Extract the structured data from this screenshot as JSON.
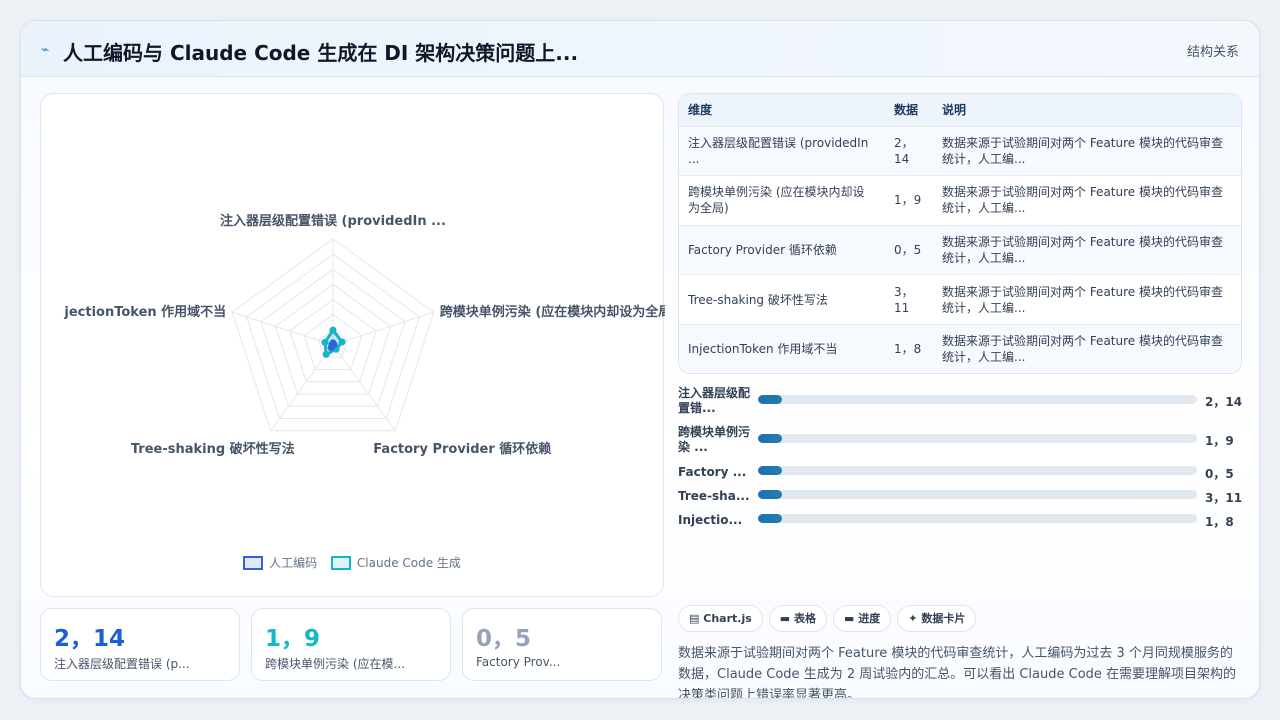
{
  "header": {
    "icon": "sparkline-icon",
    "title": "人工编码与 Claude Code 生成在 DI 架构决策问题上...",
    "tag": "结构关系"
  },
  "chart_data": {
    "type": "radar",
    "axes": [
      "注入器层级配置错误 (providedIn ...",
      "跨模块单例污染 (应在模块内却设为全局",
      "Factory Provider 循环依赖",
      "Tree-shaking 破坏性写法",
      "jectionToken 作用域不当"
    ],
    "series": [
      {
        "name": "人工编码",
        "values": [
          2,
          1,
          0,
          3,
          1
        ],
        "color": "#3163d8"
      },
      {
        "name": "Claude Code 生成",
        "values": [
          14,
          9,
          5,
          11,
          8
        ],
        "color": "#19b3c8"
      }
    ],
    "rlim": [
      0,
      100
    ],
    "rings": 7,
    "legend": "bottom"
  },
  "legend": {
    "s1": "人工编码",
    "s2": "Claude Code 生成"
  },
  "kpis": [
    {
      "value": "2，14",
      "label": "注入器层级配置错误 (p...",
      "color": "#1f5fd3"
    },
    {
      "value": "1，9",
      "label": "跨模块单例污染 (应在模...",
      "color": "#14b8c9"
    },
    {
      "value": "0，5",
      "label": "Factory Prov...",
      "color": "#94a3b8"
    }
  ],
  "table": {
    "headers": [
      "维度",
      "数据",
      "说明"
    ],
    "rows": [
      {
        "dim": "注入器层级配置错误 (providedIn ...",
        "data": "2，14",
        "desc": "数据来源于试验期间对两个 Feature 模块的代码审查统计，人工编..."
      },
      {
        "dim": "跨模块单例污染 (应在模块内却设为全局)",
        "data": "1，9",
        "desc": "数据来源于试验期间对两个 Feature 模块的代码审查统计，人工编..."
      },
      {
        "dim": "Factory Provider 循环依赖",
        "data": "0，5",
        "desc": "数据来源于试验期间对两个 Feature 模块的代码审查统计，人工编..."
      },
      {
        "dim": "Tree-shaking 破坏性写法",
        "data": "3，11",
        "desc": "数据来源于试验期间对两个 Feature 模块的代码审查统计，人工编..."
      },
      {
        "dim": "InjectionToken 作用域不当",
        "data": "1，8",
        "desc": "数据来源于试验期间对两个 Feature 模块的代码审查统计，人工编..."
      }
    ]
  },
  "bars": [
    {
      "label": "注入器层级配置错...",
      "value": "2，14",
      "fill_fraction": 0.055
    },
    {
      "label": "跨模块单例污染 ...",
      "value": "1，9",
      "fill_fraction": 0.055
    },
    {
      "label": "Factory ...",
      "value": "0，5",
      "fill_fraction": 0.055
    },
    {
      "label": "Tree-sha...",
      "value": "3，11",
      "fill_fraction": 0.055
    },
    {
      "label": "Injectio...",
      "value": "1，8",
      "fill_fraction": 0.055
    }
  ],
  "chips": [
    {
      "icon": "chart-icon",
      "glyph": "▤",
      "label": "Chart.js"
    },
    {
      "icon": "table-icon",
      "glyph": "▬",
      "label": "表格"
    },
    {
      "icon": "progress-icon",
      "glyph": "▬",
      "label": "进度"
    },
    {
      "icon": "card-icon",
      "glyph": "✦",
      "label": "数据卡片"
    }
  ],
  "note": "数据来源于试验期间对两个 Feature 模块的代码审查统计，人工编码为过去 3 个月同规模服务的数据，Claude Code 生成为 2 周试验内的汇总。可以看出 Claude Code 在需要理解项目架构的决策类问题上错误率显著更高。"
}
